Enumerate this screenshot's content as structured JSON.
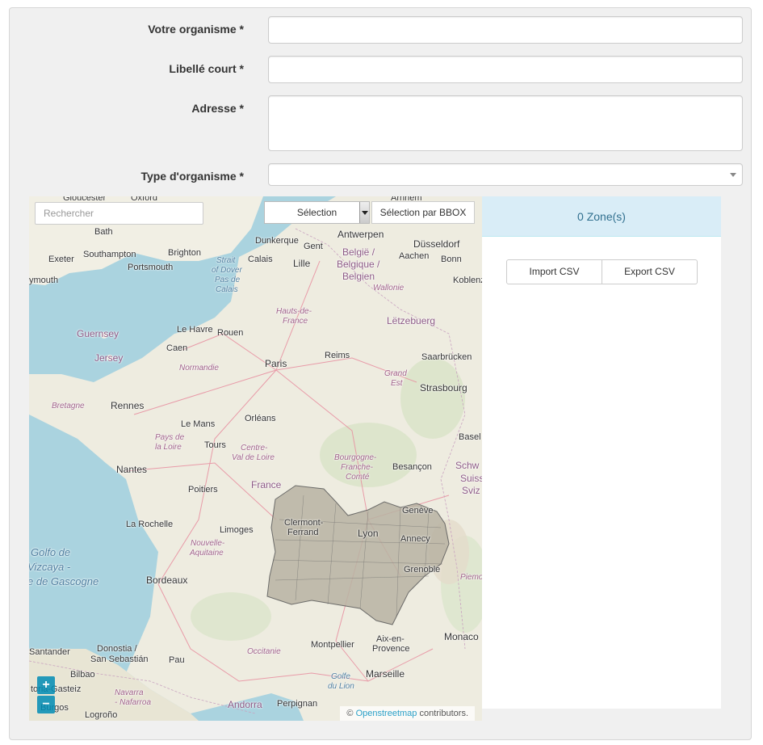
{
  "form": {
    "organisme_label": "Votre organisme *",
    "libelle_label": "Libellé court *",
    "adresse_label": "Adresse *",
    "type_label": "Type d'organisme *",
    "organisme_value": "",
    "libelle_value": "",
    "adresse_value": "",
    "type_value": ""
  },
  "map": {
    "search_placeholder": "Rechercher",
    "selection_label": "Sélection",
    "bbox_label": "Sélection par BBOX",
    "zoom_in": "+",
    "zoom_out": "−",
    "attribution_prefix": "©",
    "attribution_link": "Openstreetmap",
    "attribution_suffix": "contributors.",
    "labels": {
      "gloucester": "Gloucester",
      "oxford": "Oxford",
      "arnhem": "Arnhem",
      "bath": "Bath",
      "dunkerque": "Dunkerque",
      "gent": "Gent",
      "antwerpen": "Antwerpen",
      "dusseldorf": "Düsseldorf",
      "exeter": "Exeter",
      "southampton": "Southampton",
      "brighton": "Brighton",
      "calais": "Calais",
      "lille": "Lille",
      "belgie": "België /",
      "belgique": "Belgique /",
      "belgien": "Belgien",
      "aachen": "Aachen",
      "bonn": "Bonn",
      "portsmouth": "Portsmouth",
      "plymouth": "ymouth",
      "koblenz": "Koblenz",
      "strait": "Strait",
      "ofdover": "of Dover",
      "pasde": "Pas de",
      "pcalais": "Calais",
      "wallonie": "Wallonie",
      "hautsde": "Hauts-de-",
      "hfrance": "France",
      "letzebuerg": "Lëtzebuerg",
      "guernsey": "Guernsey",
      "lehavre": "Le Havre",
      "rouen": "Rouen",
      "jersey": "Jersey",
      "caen": "Caen",
      "reims": "Reims",
      "saarbrucken": "Saarbrücken",
      "paris": "Paris",
      "normandie": "Normandie",
      "grand": "Grand",
      "est": "Est",
      "strasbourg": "Strasbourg",
      "bretagne": "Bretagne",
      "rennes": "Rennes",
      "lemans": "Le Mans",
      "orleans": "Orléans",
      "paysde": "Pays de",
      "laloire": "la Loire",
      "tours": "Tours",
      "centre": "Centre-",
      "valdeloire": "Val de Loire",
      "bourgogne": "Bourgogne-",
      "franche": "Franche-",
      "comte": "Comté",
      "besancon": "Besançon",
      "basel": "Basel",
      "nantes": "Nantes",
      "schw": "Schw",
      "suisse": "Suisse/Sv",
      "sviz": "Sviz",
      "poitiers": "Poitiers",
      "france": "France",
      "geneve": "Genève",
      "larochelle": "La Rochelle",
      "clermont": "Clermont-",
      "ferrand": "Ferrand",
      "limoges": "Limoges",
      "lyon": "Lyon",
      "annecy": "Annecy",
      "golfode": "Golfo de",
      "vizcaya": "Vizcaya -",
      "degascogne": "e de Gascogne",
      "nouvelle": "Nouvelle-",
      "aquitaine": "Aquitaine",
      "grenoble": "Grenoble",
      "piemo": "Piemo",
      "bordeaux": "Bordeaux",
      "occitanie": "Occitanie",
      "montpellier": "Montpellier",
      "aixen": "Aix-en-",
      "provence": "Provence",
      "monaco": "Monaco",
      "santander": "Santander",
      "donostia": "Donostia /",
      "sansebastian": "San Sebastián",
      "pau": "Pau",
      "marseille": "Marseille",
      "bilbao": "Bilbao",
      "golfe": "Golfe",
      "dulion": "du Lion",
      "vitoria": "toria-Gasteiz",
      "navarra": "Navarra",
      "nafarroa": "- Nafarroa",
      "burgos": "Burgos",
      "andorra": "Andorra",
      "perpignan": "Perpignan",
      "logrono": "Logroño"
    }
  },
  "zones": {
    "header": "0 Zone(s)",
    "import_label": "Import CSV",
    "export_label": "Export CSV"
  }
}
